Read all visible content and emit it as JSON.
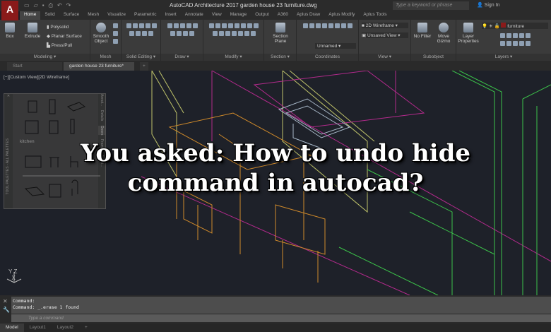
{
  "app": {
    "logo": "A",
    "title": "AutoCAD Architecture 2017   garden house 23 furniture.dwg",
    "search_placeholder": "Type a keyword or phrase",
    "sign_in": "Sign In"
  },
  "ribbon_tabs": [
    "Home",
    "Solid",
    "Surface",
    "Mesh",
    "Visualize",
    "Parametric",
    "Insert",
    "Annotate",
    "View",
    "Manage",
    "Output",
    "A360",
    "Aplus Draw",
    "Aplus Modify",
    "Aplus Tools"
  ],
  "panels": {
    "modeling": {
      "label": "Modeling ▾",
      "box": "Box",
      "extrude": "Extrude",
      "polysolid": "Polysolid",
      "planar": "Planar Surface",
      "presspull": "Press/Pull"
    },
    "mesh": {
      "label": "Mesh",
      "smooth": "Smooth Object"
    },
    "solid_editing": {
      "label": "Solid Editing ▾"
    },
    "draw": {
      "label": "Draw ▾"
    },
    "modify": {
      "label": "Modify ▾"
    },
    "section": {
      "label": "Section ▾",
      "plane": "Section Plane"
    },
    "coordinates": {
      "label": "Coordinates",
      "ucs": "Unnamed"
    },
    "view": {
      "label": "View ▾",
      "visual_style": "2D Wireframe",
      "named_view": "Unsaved View"
    },
    "subobject": {
      "label": "Subobject",
      "filter": "No Filter",
      "gizmo": "Move Gizmo"
    },
    "layers": {
      "label": "Layers ▾",
      "properties": "Layer Properties",
      "current": "furniture",
      "layer_color": "#8b1a1a"
    }
  },
  "doc_tabs": [
    "Start",
    "garden house 23 furniture*"
  ],
  "viewport": {
    "label": "[−][Custom View][2D Wireframe]",
    "palette_title": "TOOL PALETTES - ALL PALETTES",
    "palette_section": "kitchen",
    "palette_tabs": [
      "Annot...",
      "Details",
      "Doors",
      "Fram...",
      "Annot..."
    ]
  },
  "overlay": {
    "line1": "You asked: How to undo hide",
    "line2": "command in autocad?"
  },
  "command": {
    "history": [
      "Command:",
      "Command:  _.erase 1 found"
    ],
    "placeholder": "Type a command"
  },
  "layout_tabs": [
    "Model",
    "Layout1",
    "Layout2",
    "+"
  ]
}
